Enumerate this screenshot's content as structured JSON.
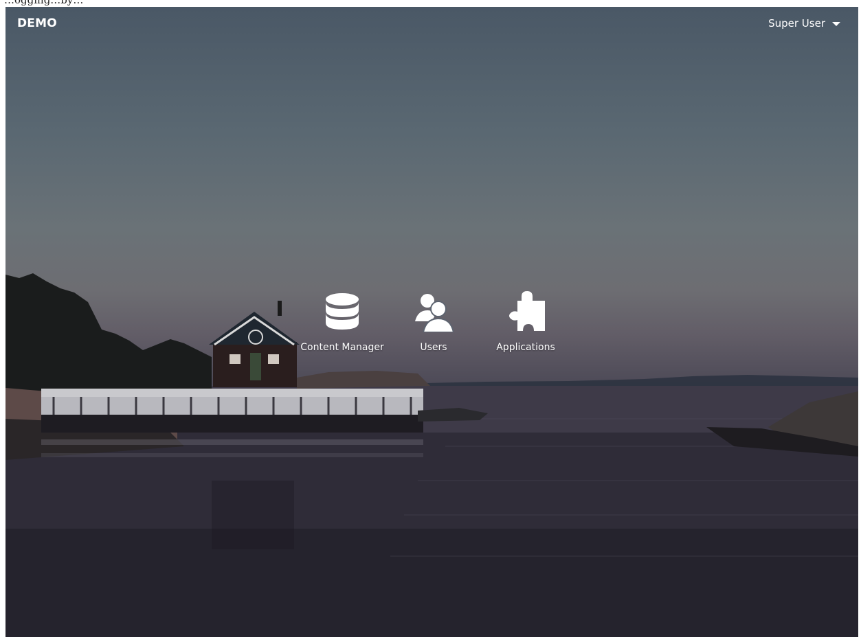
{
  "header": {
    "brand": "DEMO",
    "user_menu": {
      "label": "Super User",
      "caret_icon": "caret-down-icon"
    }
  },
  "caption_fragment": "…ogging…by…",
  "launcher": {
    "items": [
      {
        "label": "Content Manager",
        "icon": "database-icon"
      },
      {
        "label": "Users",
        "icon": "users-icon"
      },
      {
        "label": "Applications",
        "icon": "puzzle-icon"
      }
    ]
  },
  "background": {
    "scene": "lakeside house with pier at dusk",
    "sky_color": "#5a6872",
    "water_color": "#2a2833"
  }
}
